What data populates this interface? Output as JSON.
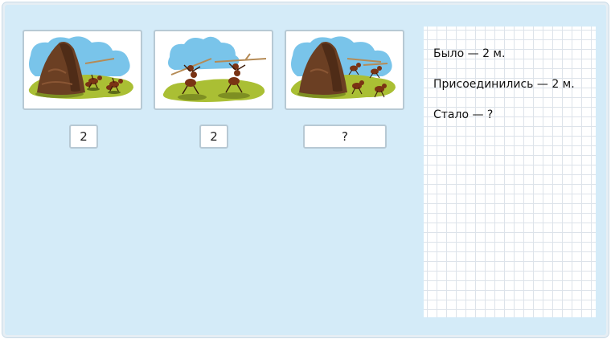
{
  "cards": [
    {
      "name": "anthill-two-ants",
      "icon": "anthill-two-ants-illustration"
    },
    {
      "name": "two-ants-with-sticks",
      "icon": "two-ants-carrying-sticks-illustration"
    },
    {
      "name": "anthill-four-ants",
      "icon": "anthill-four-ants-illustration"
    }
  ],
  "answers": [
    "2",
    "2",
    "?"
  ],
  "task": {
    "line1": "Было — 2 м.",
    "line2": "Присоединились — 2 м.",
    "line3": "Стало — ?"
  },
  "colors": {
    "background": "#d4ebf8",
    "sky": "#79c4ea",
    "grass": "#aabf34",
    "anthill": "#6b3f23",
    "ant": "#7a3314"
  }
}
